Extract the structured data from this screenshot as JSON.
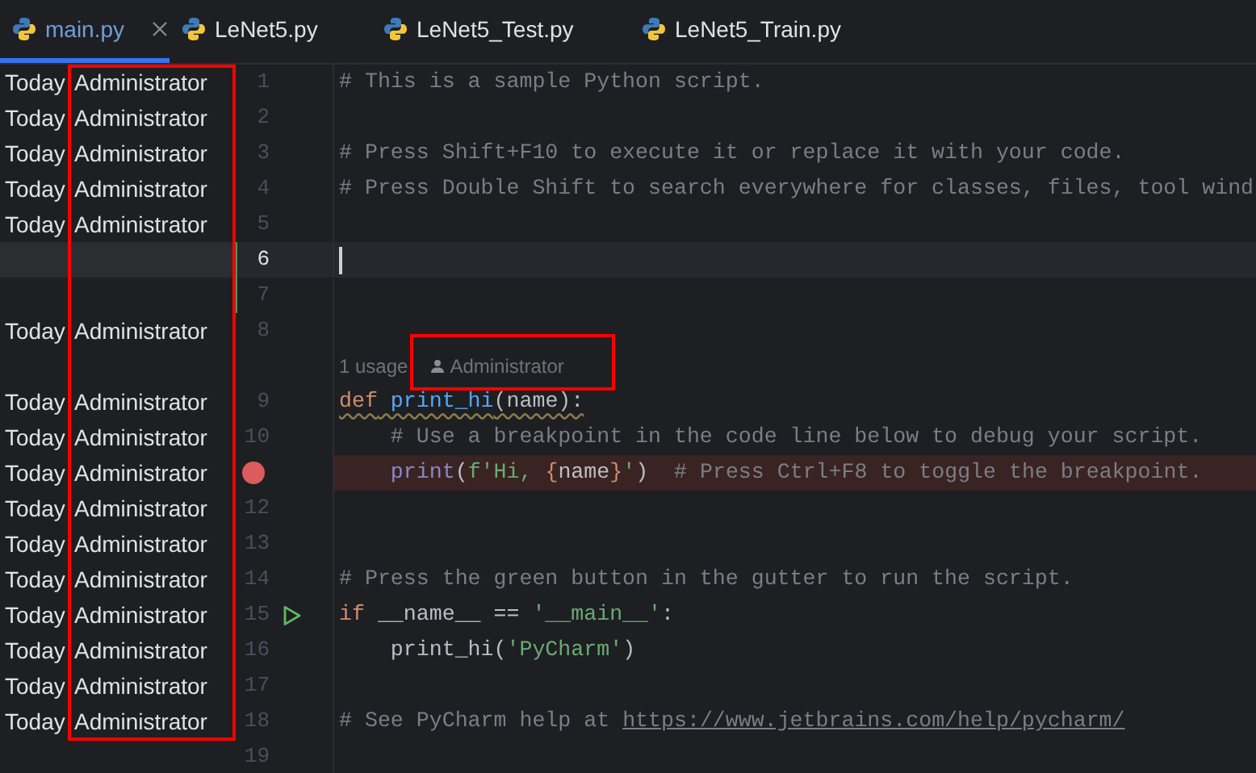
{
  "tabs": [
    {
      "label": "main.py",
      "selected": true,
      "closable": true
    },
    {
      "label": "LeNet5.py",
      "selected": false,
      "closable": false
    },
    {
      "label": "LeNet5_Test.py",
      "selected": false,
      "closable": false
    },
    {
      "label": "LeNet5_Train.py",
      "selected": false,
      "closable": false
    }
  ],
  "editor": {
    "lines": [
      {
        "kind": "code",
        "number": "1",
        "annotation": {
          "date": "Today",
          "author": "Administrator"
        },
        "tokens": [
          {
            "kind": "comment",
            "text": "# This is a sample Python script."
          }
        ]
      },
      {
        "kind": "code",
        "number": "2",
        "annotation": {
          "date": "Today",
          "author": "Administrator"
        }
      },
      {
        "kind": "code",
        "number": "3",
        "annotation": {
          "date": "Today",
          "author": "Administrator"
        },
        "tokens": [
          {
            "kind": "comment",
            "text": "# Press Shift+F10 to execute it or replace it with your code."
          }
        ]
      },
      {
        "kind": "code",
        "number": "4",
        "annotation": {
          "date": "Today",
          "author": "Administrator"
        },
        "tokens": [
          {
            "kind": "comment",
            "text": "# Press Double Shift to search everywhere for classes, files, tool wind"
          }
        ]
      },
      {
        "kind": "code",
        "number": "5",
        "annotation": {
          "date": "Today",
          "author": "Administrator"
        }
      },
      {
        "kind": "code",
        "number": "6",
        "current": true,
        "changed": true
      },
      {
        "kind": "code",
        "number": "7",
        "changed": true
      },
      {
        "kind": "code",
        "number": "8",
        "annotation": {
          "date": "Today",
          "author": "Administrator"
        }
      },
      {
        "kind": "inlay",
        "usage": "1 usage",
        "author": "Administrator"
      },
      {
        "kind": "code",
        "number": "9",
        "warning": true,
        "annotation": {
          "date": "Today",
          "author": "Administrator"
        },
        "tokens": [
          {
            "kind": "keyword",
            "text": "def"
          },
          {
            "kind": "funcdef",
            "text": " print_hi"
          },
          {
            "kind": "plain",
            "text": "(name):"
          }
        ]
      },
      {
        "kind": "code",
        "number": "10",
        "annotation": {
          "date": "Today",
          "author": "Administrator"
        },
        "tokens": [
          {
            "kind": "comment",
            "text": "    # Use a breakpoint in the code line below to debug your script."
          }
        ]
      },
      {
        "kind": "code",
        "breakpoint": true,
        "annotation": {
          "date": "Today",
          "author": "Administrator"
        },
        "tokens": [
          {
            "kind": "builtin",
            "text": "    print"
          },
          {
            "kind": "plain",
            "text": "("
          },
          {
            "kind": "string",
            "text": "f'Hi, "
          },
          {
            "kind": "brace",
            "text": "{"
          },
          {
            "kind": "plain",
            "text": "name"
          },
          {
            "kind": "brace",
            "text": "}"
          },
          {
            "kind": "string",
            "text": "'"
          },
          {
            "kind": "plain",
            "text": ")  "
          },
          {
            "kind": "comment",
            "text": "# Press Ctrl+F8 to toggle the breakpoint."
          }
        ]
      },
      {
        "kind": "code",
        "number": "12",
        "annotation": {
          "date": "Today",
          "author": "Administrator"
        }
      },
      {
        "kind": "code",
        "number": "13",
        "annotation": {
          "date": "Today",
          "author": "Administrator"
        }
      },
      {
        "kind": "code",
        "number": "14",
        "annotation": {
          "date": "Today",
          "author": "Administrator"
        },
        "tokens": [
          {
            "kind": "comment",
            "text": "# Press the green button in the gutter to run the script."
          }
        ]
      },
      {
        "kind": "code",
        "number": "15",
        "run": true,
        "annotation": {
          "date": "Today",
          "author": "Administrator"
        },
        "tokens": [
          {
            "kind": "keyword",
            "text": "if"
          },
          {
            "kind": "plain",
            "text": " __name__ == "
          },
          {
            "kind": "string",
            "text": "'__main__'"
          },
          {
            "kind": "plain",
            "text": ":"
          }
        ]
      },
      {
        "kind": "code",
        "number": "16",
        "annotation": {
          "date": "Today",
          "author": "Administrator"
        },
        "tokens": [
          {
            "kind": "plain",
            "text": "    print_hi("
          },
          {
            "kind": "string",
            "text": "'PyCharm'"
          },
          {
            "kind": "plain",
            "text": ")"
          }
        ]
      },
      {
        "kind": "code",
        "number": "17",
        "annotation": {
          "date": "Today",
          "author": "Administrator"
        }
      },
      {
        "kind": "code",
        "number": "18",
        "annotation": {
          "date": "Today",
          "author": "Administrator"
        },
        "tokens": [
          {
            "kind": "comment",
            "text": "# See PyCharm help at "
          },
          {
            "kind": "link",
            "text": "https://www.jetbrains.com/help/pycharm/"
          }
        ]
      },
      {
        "kind": "code",
        "number": "19"
      }
    ]
  }
}
